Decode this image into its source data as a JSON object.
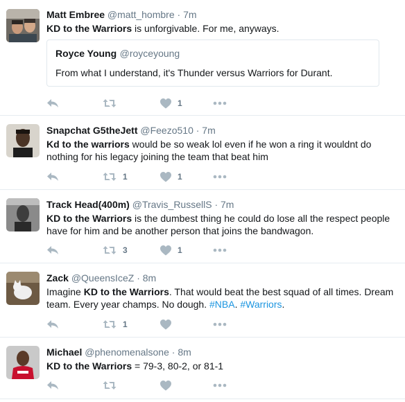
{
  "tweets": [
    {
      "fullname": "Matt Embree",
      "username": "@matt_hombre",
      "time": "· 7m",
      "text_bold": "KD to the Warriors",
      "text_rest": " is unforgivable. For me, anyways.",
      "quote": {
        "fullname": "Royce Young",
        "username": "@royceyoung",
        "text": "From what I understand, it's Thunder versus Warriors for Durant."
      },
      "retweets": "",
      "likes": "1"
    },
    {
      "fullname": "Snapchat G5theJett",
      "username": "@Feezo510",
      "time": "· 7m",
      "text_bold": "Kd to the warriors",
      "text_rest": " would be so weak lol even if he won a ring it wouldnt do nothing for his legacy joining the team that beat him",
      "retweets": "1",
      "likes": "1"
    },
    {
      "fullname": "Track Head(400m)",
      "username": "@Travis_RussellS",
      "time": "· 7m",
      "text_bold": "KD to the Warriors",
      "text_rest": " is the dumbest thing he could do lose all the respect people have for him and be another person that joins the bandwagon.",
      "retweets": "3",
      "likes": "1"
    },
    {
      "fullname": "Zack",
      "username": "@QueensIceZ",
      "time": "· 8m",
      "text_pre": "Imagine ",
      "text_bold": "KD to the Warriors",
      "text_rest": ". That would beat the best squad of all times. Dream team. Every year champs. No dough. ",
      "hashtag1": "#NBA",
      "sep": ". ",
      "hashtag2": "#Warriors",
      "end": ".",
      "retweets": "1",
      "likes": ""
    },
    {
      "fullname": "Michael",
      "username": "@phenomenalsone",
      "time": "· 8m",
      "text_bold": "KD to the Warriors",
      "text_rest": " = 79-3, 80-2, or 81-1",
      "retweets": "",
      "likes": ""
    }
  ],
  "icons": {
    "reply": "reply-icon",
    "retweet": "retweet-icon",
    "like": "heart-icon",
    "more": "more-icon"
  },
  "colors": {
    "link": "#1b95e0",
    "action": "#aab8c2",
    "divider": "#e6ecf0"
  }
}
